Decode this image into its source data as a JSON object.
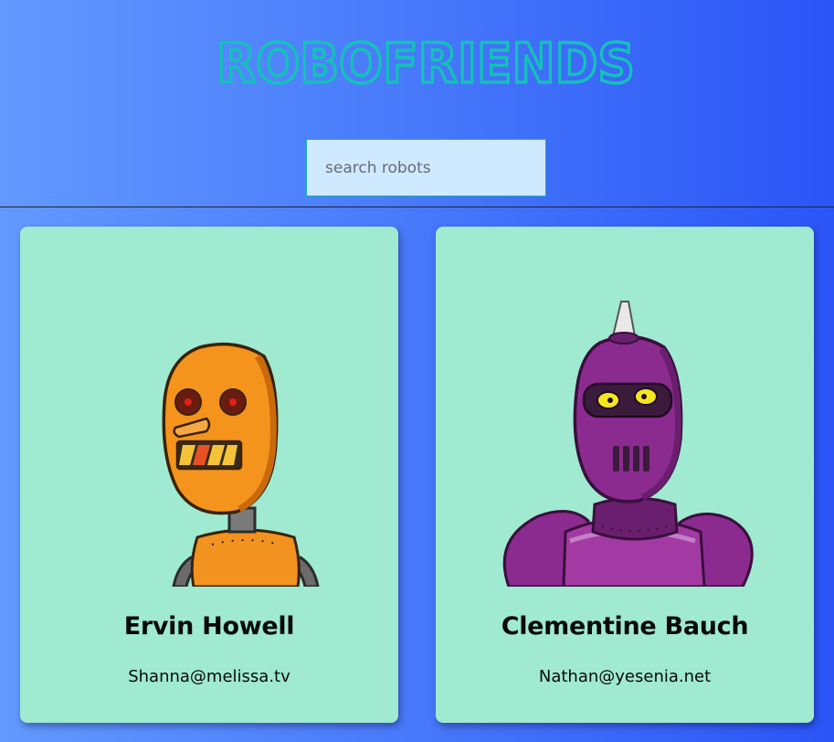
{
  "app": {
    "logo_text": "ROBOFRIENDS",
    "colors": {
      "logo": "#13c2b8",
      "card_background": "#9fead1",
      "search_background": "#cfe9ff",
      "search_border": "#12b3a8"
    }
  },
  "search": {
    "placeholder": "search robots",
    "value": ""
  },
  "robots": [
    {
      "name": "Ervin Howell",
      "email": "Shanna@melissa.tv",
      "avatar_icon": "orange-robot-avatar"
    },
    {
      "name": "Clementine Bauch",
      "email": "Nathan@yesenia.net",
      "avatar_icon": "purple-robot-avatar"
    }
  ]
}
